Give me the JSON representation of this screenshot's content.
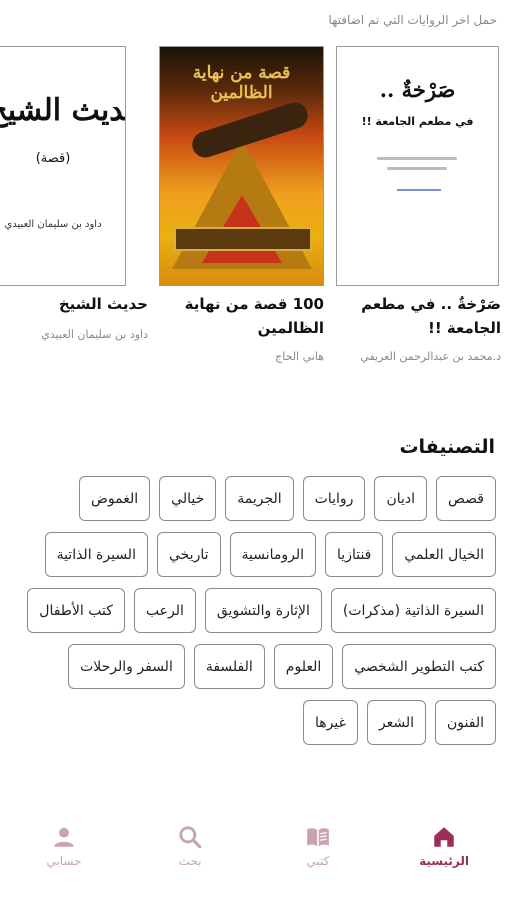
{
  "hint": "حمل اخر الروايات التي تم اضافتها",
  "books": [
    {
      "title": "صَرْخةٌ .. في مطعم الجامعة !!",
      "author": "د.محمد بن عبدالرحمن العريفي",
      "cover_title": "صَرْخةٌ ..",
      "cover_subtitle": "في مطعم الجامعة !!"
    },
    {
      "title": "100 قصة من نهاية الظالمين",
      "author": "هاني الحاج",
      "cover_title": "قصة من نهاية الظالمين"
    },
    {
      "title": "حديث الشيخ",
      "author": "داود بن سليمان العبيدي",
      "cover_title": "حديث الشيخ",
      "cover_subtitle": "(قصة)",
      "cover_author": "داود بن سليمان العبيدي"
    }
  ],
  "categories_title": "التصنيفات",
  "categories": [
    [
      "قصص",
      "اديان",
      "روايات",
      "الجريمة",
      "خيالي",
      "الغموض"
    ],
    [
      "الخيال العلمي",
      "فنتازيا",
      "الرومانسية",
      "تاريخي",
      "السيرة الذاتية"
    ],
    [
      "السيرة الذاتية (مذكرات)",
      "الإثارة والتشويق",
      "الرعب",
      "كتب الأطفال"
    ],
    [
      "كتب التطوير الشخصي",
      "العلوم",
      "الفلسفة",
      "السفر والرحلات"
    ],
    [
      "الفنون",
      "الشعر",
      "غيرها"
    ]
  ],
  "nav": {
    "home": "الرئيسية",
    "books": "كتبي",
    "search": "بحث",
    "account": "حسابي"
  },
  "colors": {
    "accent": "#9b2f5a",
    "inactive": "#c9a3b1"
  }
}
